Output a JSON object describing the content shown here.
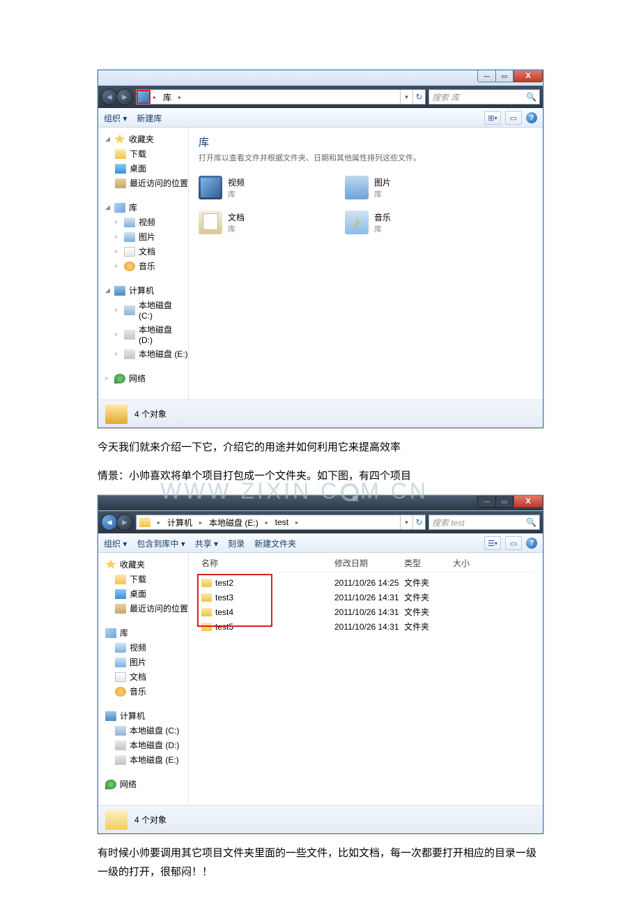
{
  "article": {
    "p1": "今天我们就来介绍一下它，介绍它的用途并如何利用它来提高效率",
    "p2": "情景：小帅喜欢将单个项目打包成一个文件夹。如下图，有四个项目",
    "p3": "有时候小帅要调用其它项目文件夹里面的一些文件，比如文档，每一次都要打开相应的目录一级一级的打开，很郁闷！！"
  },
  "win_controls": {
    "min": "—",
    "max": "▭",
    "close": "X"
  },
  "explorer1": {
    "address": {
      "root": "库",
      "arrow": "▸"
    },
    "search_placeholder": "搜索 库",
    "toolbar": {
      "organize": "组织 ▾",
      "newlib": "新建库",
      "view_tri": "▾"
    },
    "sidebar": {
      "favorites": "收藏夹",
      "downloads": "下载",
      "desktop": "桌面",
      "recent": "最近访问的位置",
      "library": "库",
      "video": "视频",
      "pictures": "图片",
      "documents": "文档",
      "music": "音乐",
      "computer": "计算机",
      "drvC": "本地磁盘 (C:)",
      "drvD": "本地磁盘 (D:)",
      "drvE": "本地磁盘 (E:)",
      "network": "网络"
    },
    "content": {
      "title": "库",
      "subtitle": "打开库以查看文件并根据文件夹、日期和其他属性排列这些文件。",
      "items": {
        "video": {
          "name": "视频",
          "sub": "库"
        },
        "pictures": {
          "name": "图片",
          "sub": "库"
        },
        "documents": {
          "name": "文档",
          "sub": "库"
        },
        "music": {
          "name": "音乐",
          "sub": "库"
        }
      }
    },
    "status": "4 个对象"
  },
  "explorer2": {
    "address": {
      "seg1": "计算机",
      "seg2": "本地磁盘 (E:)",
      "seg3": "test",
      "arrow": "▸"
    },
    "search_placeholder": "搜索 test",
    "toolbar": {
      "organize": "组织 ▾",
      "include": "包含到库中 ▾",
      "share": "共享 ▾",
      "burn": "刻录",
      "newfolder": "新建文件夹",
      "view_tri": "▾"
    },
    "sidebar": {
      "favorites": "收藏夹",
      "downloads": "下载",
      "desktop": "桌面",
      "recent": "最近访问的位置",
      "library": "库",
      "video": "视频",
      "pictures": "图片",
      "documents": "文档",
      "music": "音乐",
      "computer": "计算机",
      "drvC": "本地磁盘 (C:)",
      "drvD": "本地磁盘 (D:)",
      "drvE": "本地磁盘 (E:)",
      "network": "网络"
    },
    "columns": {
      "name": "名称",
      "date": "修改日期",
      "type": "类型",
      "size": "大小"
    },
    "rows": [
      {
        "name": "test2",
        "date": "2011/10/26 14:25",
        "type": "文件夹",
        "size": ""
      },
      {
        "name": "test3",
        "date": "2011/10/26 14:31",
        "type": "文件夹",
        "size": ""
      },
      {
        "name": "test4",
        "date": "2011/10/26 14:31",
        "type": "文件夹",
        "size": ""
      },
      {
        "name": "test5",
        "date": "2011/10/26 14:31",
        "type": "文件夹",
        "size": ""
      }
    ],
    "status": "4 个对象"
  },
  "watermark": "www.zixin.com.cn"
}
